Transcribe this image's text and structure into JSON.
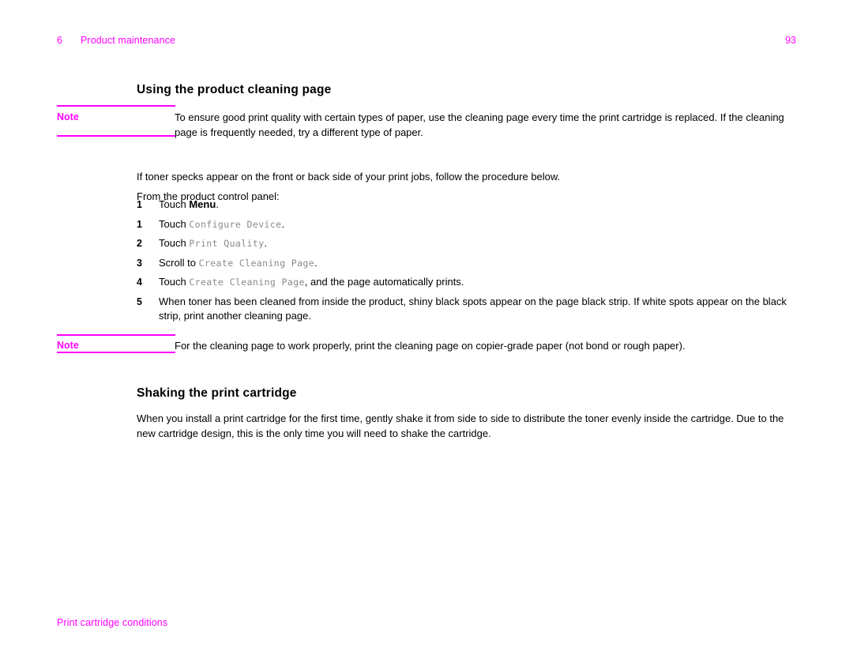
{
  "header": {
    "chapter_number": "6",
    "chapter_title": "Product maintenance",
    "page_number": "93"
  },
  "sections": {
    "cleaning": {
      "heading": "Using the product cleaning page",
      "note_label": "Note",
      "note_text": "To ensure good print quality with certain types of paper, use the cleaning page every time the print cartridge is replaced. If the cleaning page is frequently needed, try a different type of paper.",
      "intro_paragraph": "If toner specks appear on the front or back side of your print jobs, follow the procedure below.",
      "lead_in": "From the product control panel:",
      "steps": [
        {
          "number": "1",
          "prefix": "Touch ",
          "emphasis": "Menu",
          "emphasis_style": "bold",
          "suffix": "."
        },
        {
          "number": "1",
          "prefix": "Touch ",
          "emphasis": "Configure Device",
          "emphasis_style": "mono",
          "suffix": "."
        },
        {
          "number": "2",
          "prefix": "Touch ",
          "emphasis": "Print Quality",
          "emphasis_style": "mono",
          "suffix": "."
        },
        {
          "number": "3",
          "prefix": "Scroll to ",
          "emphasis": "Create Cleaning Page",
          "emphasis_style": "mono",
          "suffix": "."
        },
        {
          "number": "4",
          "prefix": "Touch ",
          "emphasis": "Create Cleaning Page",
          "emphasis_style": "mono",
          "suffix": ", and the page automatically prints."
        },
        {
          "number": "5",
          "prefix": "When toner has been cleaned from inside the product, shiny black spots appear on the page black strip. If white spots appear on the black strip, print another cleaning page.",
          "emphasis": "",
          "emphasis_style": "none",
          "suffix": ""
        }
      ],
      "note2_label": "Note",
      "note2_text": "For the cleaning page to work properly, print the cleaning page on copier-grade paper (not bond or rough paper)."
    },
    "shaking": {
      "heading": "Shaking the print cartridge",
      "paragraph": "When you install a print cartridge for the first time, gently shake it from side to side to distribute the toner evenly inside the cartridge. Due to the new cartridge design, this is the only time you will need to shake the cartridge."
    }
  },
  "footer": {
    "text": "Print cartridge conditions"
  },
  "colors": {
    "accent_magenta": "#ff00ff",
    "body_text": "#000000",
    "monospace_text": "#8a8a8a",
    "page_background": "#ffffff"
  }
}
